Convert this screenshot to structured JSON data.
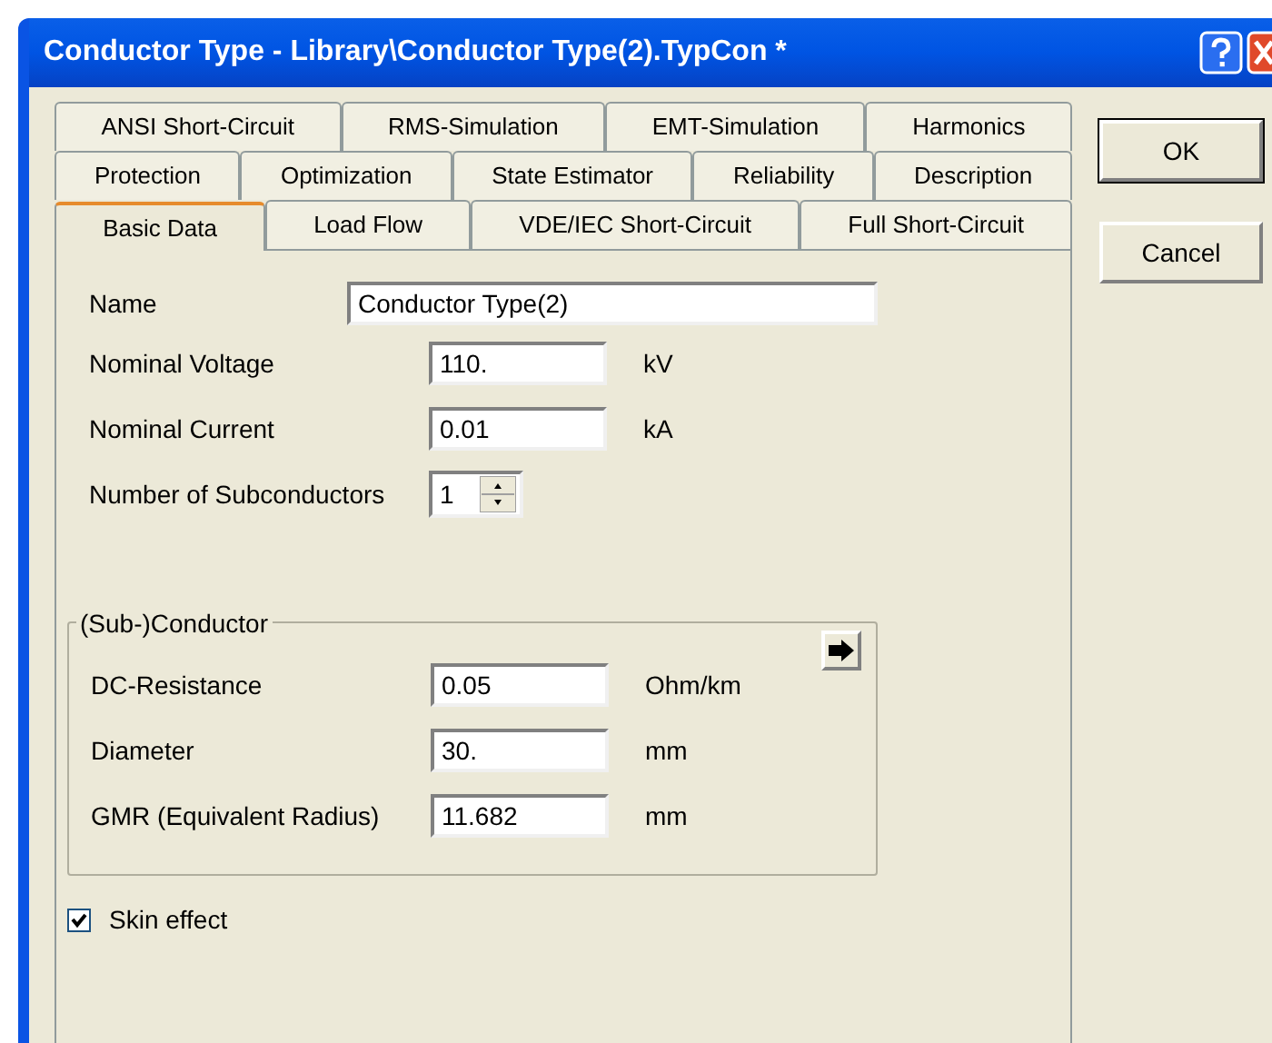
{
  "window": {
    "title": "Conductor Type - Library\\Conductor Type(2).TypCon *"
  },
  "tab_rows": [
    [
      {
        "label": "ANSI Short-Circuit",
        "selected": false
      },
      {
        "label": "RMS-Simulation",
        "selected": false
      },
      {
        "label": "EMT-Simulation",
        "selected": false
      },
      {
        "label": "Harmonics",
        "selected": false
      }
    ],
    [
      {
        "label": "Protection",
        "selected": false
      },
      {
        "label": "Optimization",
        "selected": false
      },
      {
        "label": "State Estimator",
        "selected": false
      },
      {
        "label": "Reliability",
        "selected": false
      },
      {
        "label": "Description",
        "selected": false
      }
    ],
    [
      {
        "label": "Basic Data",
        "selected": true
      },
      {
        "label": "Load Flow",
        "selected": false
      },
      {
        "label": "VDE/IEC Short-Circuit",
        "selected": false
      },
      {
        "label": "Full Short-Circuit",
        "selected": false
      }
    ]
  ],
  "buttons": [
    {
      "label": "OK",
      "default": true
    },
    {
      "label": "Cancel",
      "default": false
    }
  ],
  "name_field": {
    "label": "Name",
    "value": "Conductor Type(2)"
  },
  "fields": [
    {
      "kind": "text",
      "label": "Nominal Voltage",
      "value": "110.",
      "unit": "kV"
    },
    {
      "kind": "text",
      "label": "Nominal Current",
      "value": "0.01",
      "unit": "kA"
    },
    {
      "kind": "spinner",
      "label": "Number of Subconductors",
      "value": "1"
    }
  ],
  "subconductor": {
    "title": "(Sub-)Conductor",
    "fields": [
      {
        "label": "DC-Resistance",
        "value": "0.05",
        "unit": "Ohm/km"
      },
      {
        "label": "Diameter",
        "value": "30.",
        "unit": "mm"
      },
      {
        "label": "GMR (Equivalent Radius)",
        "value": "11.682",
        "unit": "mm"
      }
    ]
  },
  "skin_effect": {
    "label": "Skin effect",
    "checked": true
  }
}
